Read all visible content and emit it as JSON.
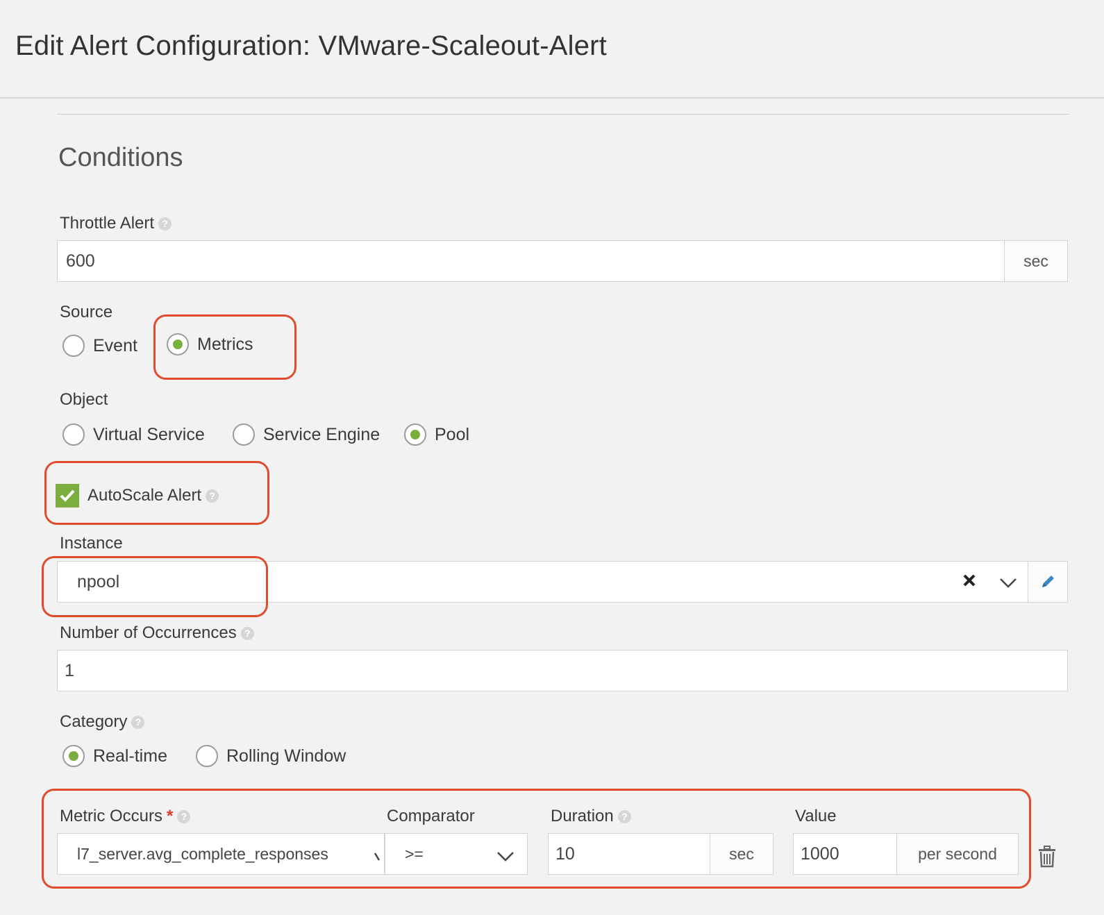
{
  "header": {
    "title": "Edit Alert Configuration: VMware-Scaleout-Alert"
  },
  "section": {
    "title": "Conditions"
  },
  "throttle": {
    "label": "Throttle Alert",
    "value": "600",
    "unit": "sec"
  },
  "source": {
    "label": "Source",
    "options": [
      "Event",
      "Metrics"
    ],
    "selected": "Metrics"
  },
  "object": {
    "label": "Object",
    "options": [
      "Virtual Service",
      "Service Engine",
      "Pool"
    ],
    "selected": "Pool"
  },
  "autoscale": {
    "label": "AutoScale Alert",
    "checked": true
  },
  "instance": {
    "label": "Instance",
    "value": "npool"
  },
  "occurrences": {
    "label": "Number of Occurrences",
    "value": "1"
  },
  "category": {
    "label": "Category",
    "options": [
      "Real-time",
      "Rolling Window"
    ],
    "selected": "Real-time"
  },
  "metric": {
    "metric_label": "Metric Occurs",
    "required_mark": "*",
    "metric_value": "l7_server.avg_complete_responses",
    "comparator_label": "Comparator",
    "comparator_value": ">=",
    "duration_label": "Duration",
    "duration_value": "10",
    "duration_unit": "sec",
    "value_label": "Value",
    "value_value": "1000",
    "value_unit": "per second"
  },
  "colors": {
    "accent": "#7cae3e",
    "highlight": "#e04b2e",
    "required": "#e03b2b"
  }
}
